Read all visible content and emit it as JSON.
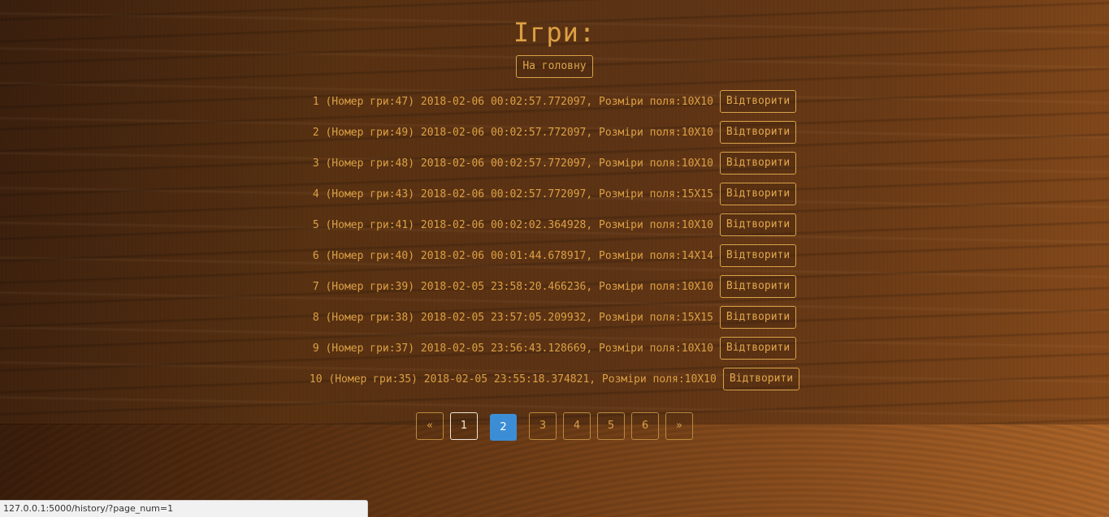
{
  "page": {
    "title": "Ігри:",
    "home_button": "На головну"
  },
  "games": [
    {
      "text": "1 (Номер гри:47) 2018-02-06 00:02:57.772097, Розміри поля:10X10",
      "button": "Відтворити"
    },
    {
      "text": "2 (Номер гри:49) 2018-02-06 00:02:57.772097, Розміри поля:10X10",
      "button": "Відтворити"
    },
    {
      "text": "3 (Номер гри:48) 2018-02-06 00:02:57.772097, Розміри поля:10X10",
      "button": "Відтворити"
    },
    {
      "text": "4 (Номер гри:43) 2018-02-06 00:02:57.772097, Розміри поля:15X15",
      "button": "Відтворити"
    },
    {
      "text": "5 (Номер гри:41) 2018-02-06 00:02:02.364928, Розміри поля:10X10",
      "button": "Відтворити"
    },
    {
      "text": "6 (Номер гри:40) 2018-02-06 00:01:44.678917, Розміри поля:14X14",
      "button": "Відтворити"
    },
    {
      "text": "7 (Номер гри:39) 2018-02-05 23:58:20.466236, Розміри поля:10X10",
      "button": "Відтворити"
    },
    {
      "text": "8 (Номер гри:38) 2018-02-05 23:57:05.209932, Розміри поля:15X15",
      "button": "Відтворити"
    },
    {
      "text": "9 (Номер гри:37) 2018-02-05 23:56:43.128669, Розміри поля:10X10",
      "button": "Відтворити"
    },
    {
      "text": "10 (Номер гри:35) 2018-02-05 23:55:18.374821, Розміри поля:10X10",
      "button": "Відтворити"
    }
  ],
  "pagination": {
    "prev": "«",
    "pages": [
      "1",
      "2",
      "3",
      "4",
      "5",
      "6"
    ],
    "next": "»",
    "active_page": "2",
    "hovered_page": "1"
  },
  "status_bar": {
    "url": "127.0.0.1:5000/history/?page_num=1"
  },
  "colors": {
    "text_gold": "#dca044",
    "active_page_blue": "#3b8ed6",
    "wood_dark": "#3a1f0d",
    "wood_light": "#8a4c1c"
  }
}
